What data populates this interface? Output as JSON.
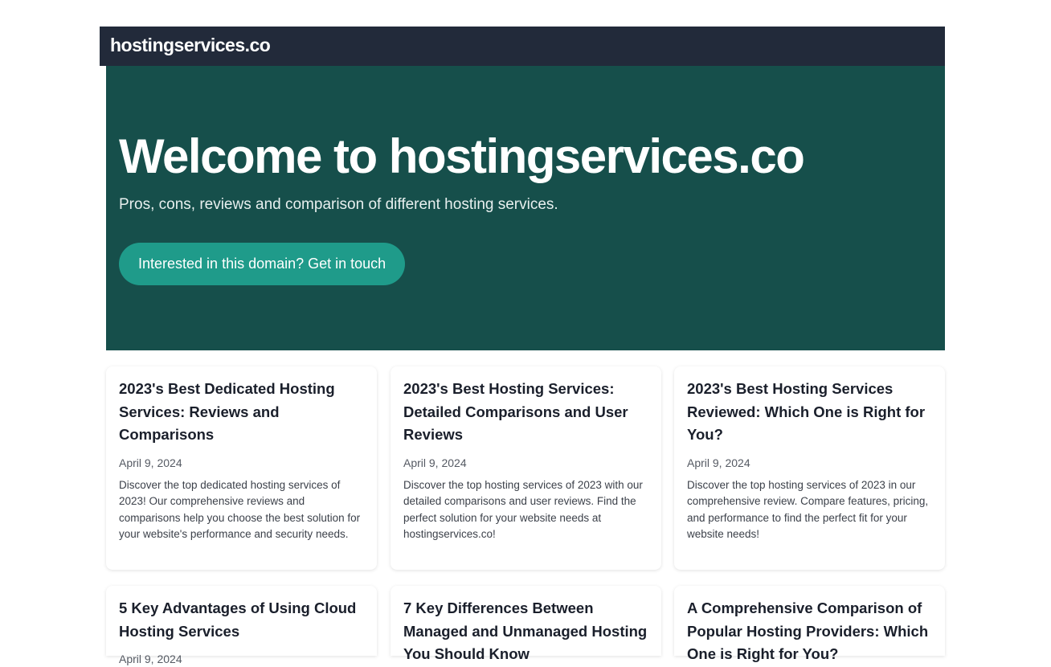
{
  "header": {
    "logo_text": "hostingservices.co"
  },
  "hero": {
    "title": "Welcome to hostingservices.co",
    "subtitle": "Pros, cons, reviews and comparison of different hosting services.",
    "cta_label": "Interested in this domain? Get in touch"
  },
  "posts": [
    {
      "title": "2023's Best Dedicated Hosting Services: Reviews and Comparisons",
      "date": "April 9, 2024",
      "description": "Discover the top dedicated hosting services of 2023! Our comprehensive reviews and comparisons help you choose the best solution for your website's performance and security needs."
    },
    {
      "title": "2023's Best Hosting Services: Detailed Comparisons and User Reviews",
      "date": "April 9, 2024",
      "description": "Discover the top hosting services of 2023 with our detailed comparisons and user reviews. Find the perfect solution for your website needs at hostingservices.co!"
    },
    {
      "title": "2023's Best Hosting Services Reviewed: Which One is Right for You?",
      "date": "April 9, 2024",
      "description": "Discover the top hosting services of 2023 in our comprehensive review. Compare features, pricing, and performance to find the perfect fit for your website needs!"
    },
    {
      "title": "5 Key Advantages of Using Cloud Hosting Services",
      "date": "April 9, 2024",
      "description": ""
    },
    {
      "title": "7 Key Differences Between Managed and Unmanaged Hosting You Should Know",
      "date": "",
      "description": ""
    },
    {
      "title": "A Comprehensive Comparison of Popular Hosting Providers: Which One is Right for You?",
      "date": "",
      "description": ""
    }
  ]
}
